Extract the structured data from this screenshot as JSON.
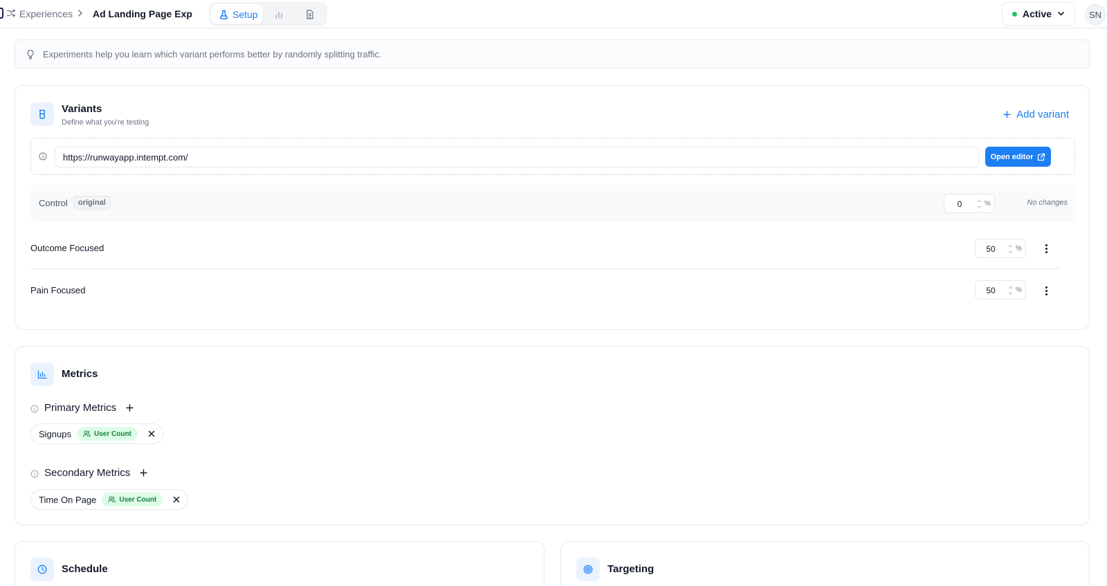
{
  "breadcrumb": {
    "root": "Experiences",
    "current": "Ad Landing Page Exp"
  },
  "tabs": {
    "setup_label": "Setup"
  },
  "status": {
    "label": "Active",
    "color": "#22c55e"
  },
  "user": {
    "initials": "SN"
  },
  "info_banner": {
    "text": "Experiments help you learn which variant performs better by randomly splitting traffic."
  },
  "variants": {
    "title": "Variants",
    "subtitle": "Define what you're testing",
    "add_label": "Add variant",
    "url": "https://runwayapp.intempt.com/",
    "open_editor_label": "Open editor",
    "control": {
      "label": "Control",
      "badge": "original",
      "percent": "0",
      "note": "No changes"
    },
    "items": [
      {
        "name": "Outcome Focused",
        "percent": "50"
      },
      {
        "name": "Pain Focused",
        "percent": "50"
      }
    ],
    "percent_sign": "%"
  },
  "metrics": {
    "title": "Metrics",
    "primary": {
      "label": "Primary Metrics",
      "chips": [
        {
          "name": "Signups",
          "badge": "User Count"
        }
      ]
    },
    "secondary": {
      "label": "Secondary Metrics",
      "chips": [
        {
          "name": "Time On Page",
          "badge": "User Count"
        }
      ]
    }
  },
  "schedule": {
    "title": "Schedule"
  },
  "targeting": {
    "title": "Targeting"
  },
  "colors": {
    "accent": "#1e7ff2",
    "badge_green_bg": "#dcfce7",
    "badge_green_text": "#15803d"
  }
}
